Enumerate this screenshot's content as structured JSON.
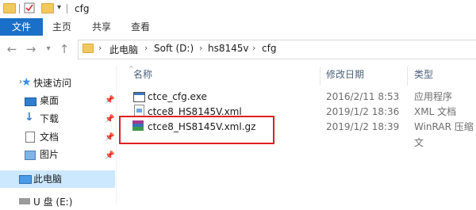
{
  "window": {
    "title": "cfg"
  },
  "ribbon": {
    "tabs": [
      "文件",
      "主页",
      "共享",
      "查看"
    ]
  },
  "address": {
    "crumbs": [
      "此电脑",
      "Soft (D:)",
      "hs8145v",
      "cfg"
    ]
  },
  "sidebar": {
    "quick_access": "快速访问",
    "items": [
      {
        "label": "桌面"
      },
      {
        "label": "下载"
      },
      {
        "label": "文档"
      },
      {
        "label": "图片"
      }
    ],
    "this_pc": "此电脑",
    "drive": "U 盘 (E:)"
  },
  "columns": {
    "name": "名称",
    "date": "修改日期",
    "type": "类型"
  },
  "files": [
    {
      "name": "ctce_cfg.exe",
      "date": "2016/2/11 8:53",
      "type": "应用程序",
      "icon": "exe-icon"
    },
    {
      "name": "ctce8_HS8145V.xml",
      "date": "2019/1/2 18:36",
      "type": "XML 文档",
      "icon": "xml-icon"
    },
    {
      "name": "ctce8_HS8145V.xml.gz",
      "date": "2019/1/2 18:39",
      "type": "WinRAR 压缩文",
      "icon": "winrar-icon"
    }
  ],
  "colors": {
    "accent": "#1a6fc9",
    "highlight": "#e02020",
    "selected": "#cce8ff"
  }
}
